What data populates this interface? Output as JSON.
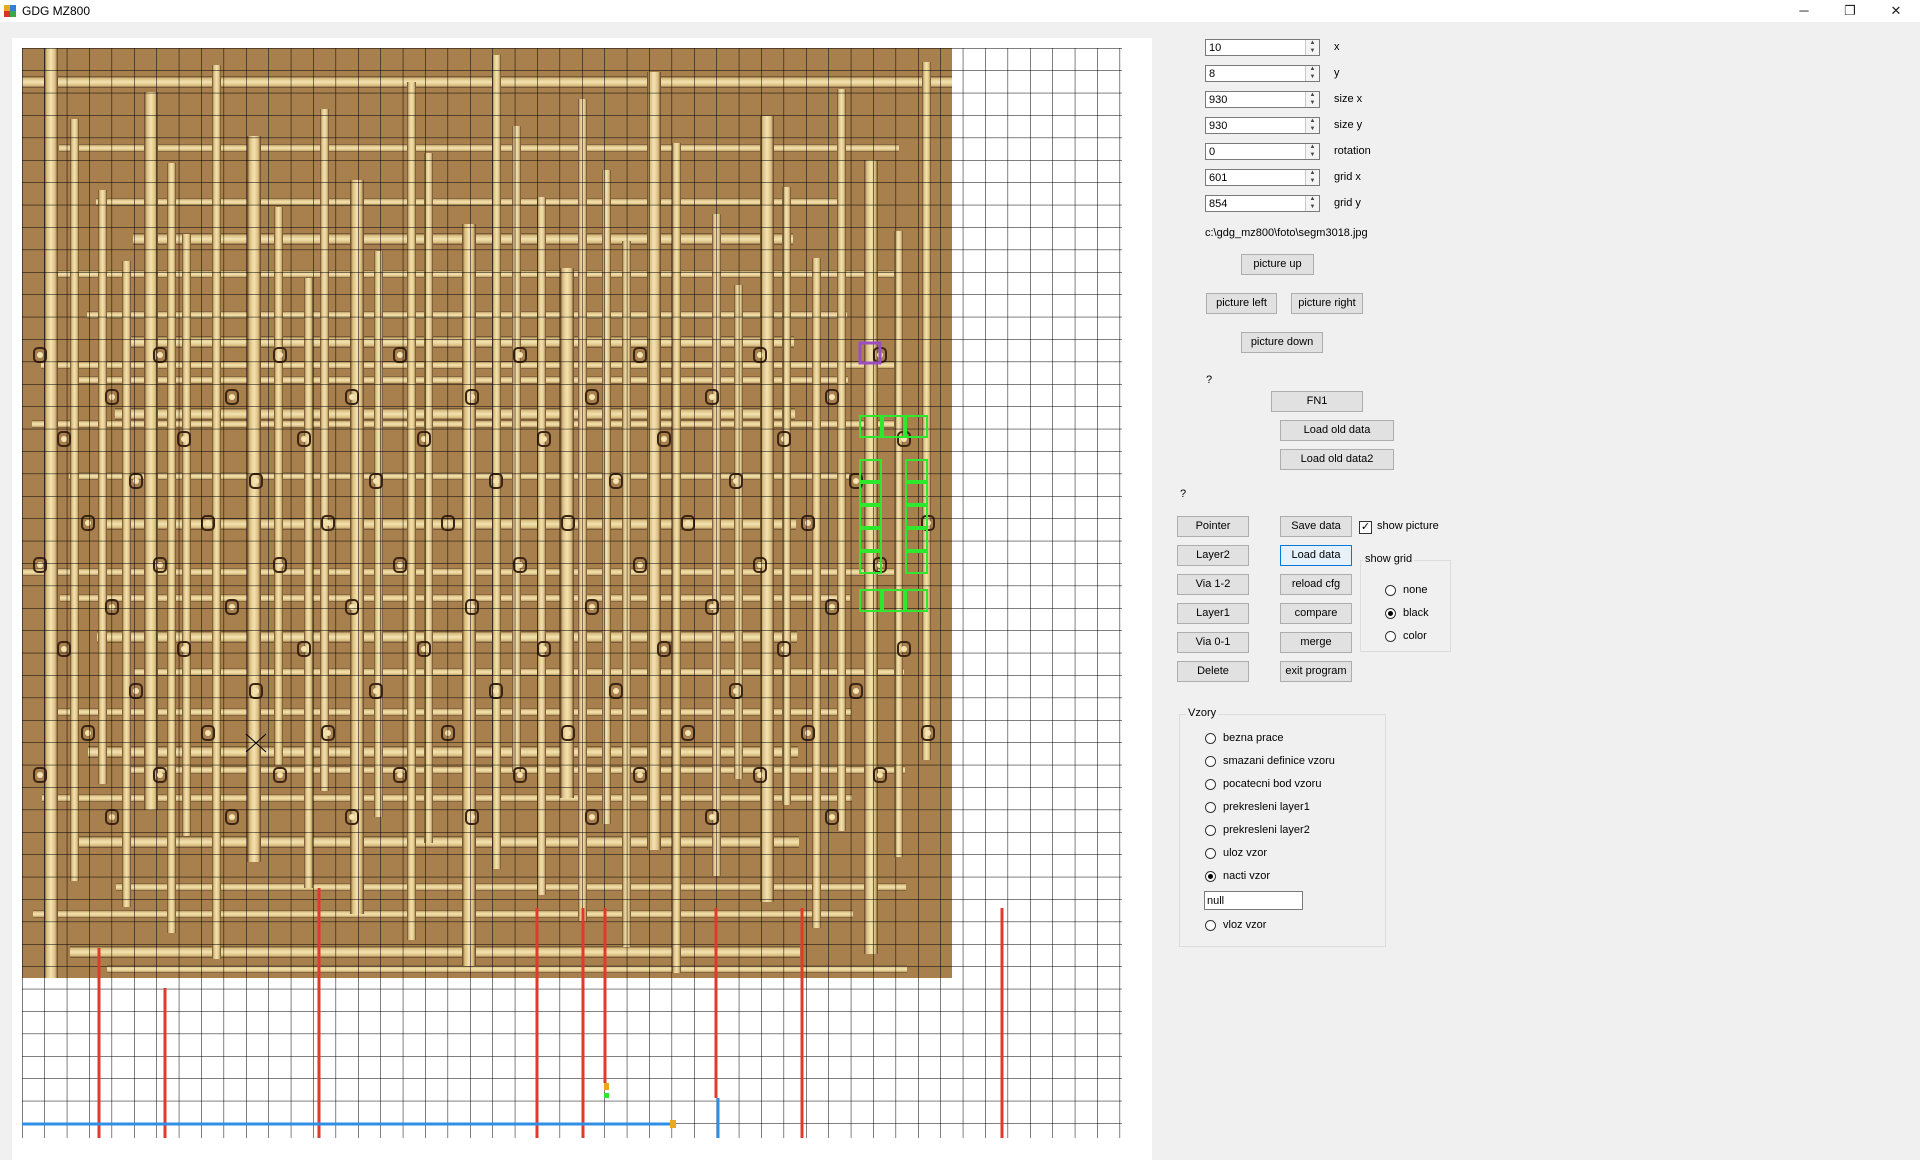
{
  "window": {
    "title": "GDG MZ800",
    "minimize_glyph": "─",
    "restore_glyph": "❐",
    "close_glyph": "✕"
  },
  "colors": {
    "die_base": "#a8804e",
    "metal": "#e6cf92",
    "via_outline": "#2ee82e",
    "red_line": "#e03a2c",
    "blue_line": "#2f8fe6",
    "purple_mark": "#9b4ec4"
  },
  "fields": [
    {
      "value": "10",
      "label": "x"
    },
    {
      "value": "8",
      "label": "y"
    },
    {
      "value": "930",
      "label": "size x"
    },
    {
      "value": "930",
      "label": "size y"
    },
    {
      "value": "0",
      "label": "rotation"
    },
    {
      "value": "601",
      "label": "grid x"
    },
    {
      "value": "854",
      "label": "grid y"
    }
  ],
  "file_path": "c:\\gdg_mz800\\foto\\segm3018.jpg",
  "nav": {
    "up": "picture up",
    "left": "picture left",
    "right": "picture right",
    "down": "picture down"
  },
  "question1": "?",
  "question2": "?",
  "fn_buttons": {
    "fn1": "FN1",
    "load_old": "Load old data",
    "load_old2": "Load old data2"
  },
  "tools": {
    "pointer": "Pointer",
    "layer2": "Layer2",
    "via12": "Via 1-2",
    "layer1": "Layer1",
    "via01": "Via 0-1",
    "delete": "Delete"
  },
  "actions": {
    "save": "Save data",
    "load": "Load data",
    "reload": "reload cfg",
    "compare": "compare",
    "merge": "merge",
    "exit": "exit program"
  },
  "show_picture": {
    "label": "show picture",
    "checked": true,
    "check_glyph": "✓"
  },
  "show_grid": {
    "title": "show grid",
    "options": [
      "none",
      "black",
      "color"
    ],
    "selected": 1
  },
  "vzory": {
    "title": "Vzory",
    "options": [
      "bezna prace",
      "smazani definice vzoru",
      "pocatecni bod vzoru",
      "prekresleni layer1",
      "prekresleni layer2",
      "uloz vzor",
      "nacti vzor"
    ],
    "selected": 6,
    "textbox_value": "null",
    "last_option": "vloz vzor"
  }
}
